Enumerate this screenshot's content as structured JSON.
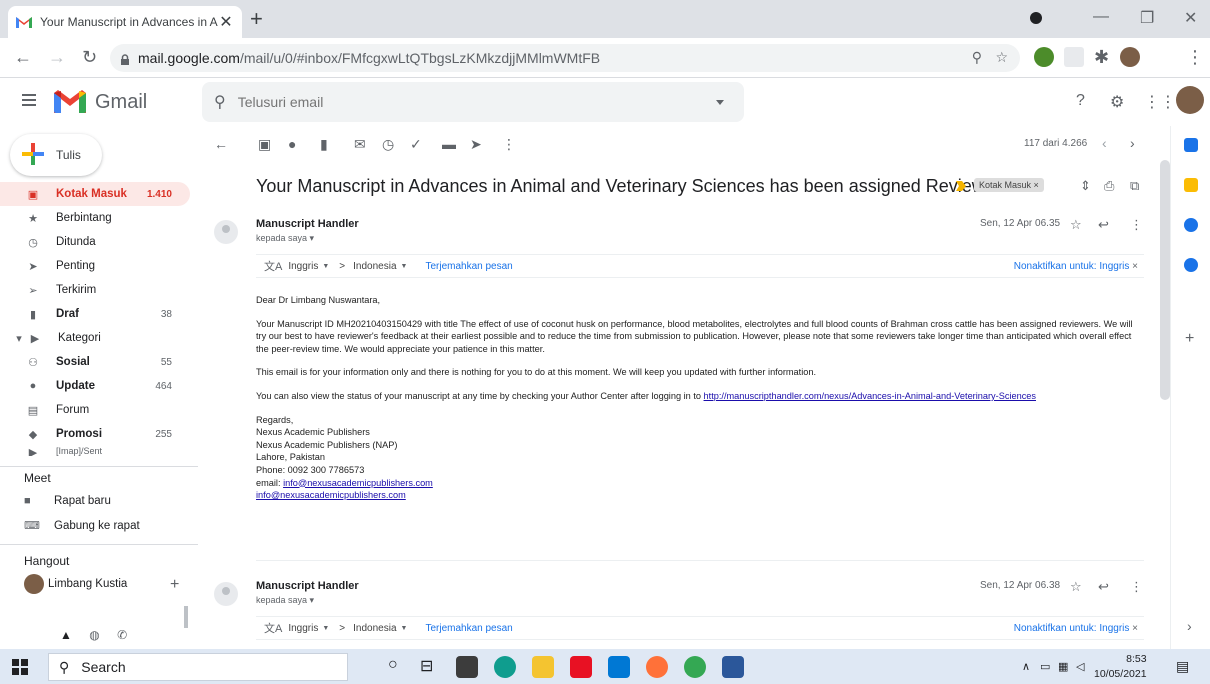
{
  "browser": {
    "tab_title": "Your Manuscript in Advances in A",
    "tab_close": "✕",
    "new_tab": "+",
    "url_host": "mail.google.com",
    "url_path": "/mail/u/0/#inbox/FMfcgxwLtQTbgsLzKMkzdjjMMlmWMtFB"
  },
  "gmail": {
    "logo_text": "Gmail",
    "search_placeholder": "Telusuri email",
    "compose_label": "Tulis"
  },
  "sidebar": {
    "items": [
      {
        "label": "Kotak Masuk",
        "count": "1.410",
        "icon": "inbox-icon"
      },
      {
        "label": "Berbintang",
        "count": "",
        "icon": "star-icon"
      },
      {
        "label": "Ditunda",
        "count": "",
        "icon": "clock-icon"
      },
      {
        "label": "Penting",
        "count": "",
        "icon": "important-icon"
      },
      {
        "label": "Terkirim",
        "count": "",
        "icon": "send-icon"
      },
      {
        "label": "Draf",
        "count": "38",
        "icon": "draft-icon"
      },
      {
        "label": "Kategori",
        "count": "",
        "icon": "label-icon"
      },
      {
        "label": "Sosial",
        "count": "55",
        "icon": "people-icon"
      },
      {
        "label": "Update",
        "count": "464",
        "icon": "info-icon"
      },
      {
        "label": "Forum",
        "count": "",
        "icon": "forum-icon"
      },
      {
        "label": "Promosi",
        "count": "255",
        "icon": "tag-icon"
      },
      {
        "label": "[Imap]/Sent",
        "count": "",
        "icon": "label-icon"
      }
    ],
    "meet_title": "Meet",
    "meet_new": "Rapat baru",
    "meet_join": "Gabung ke rapat",
    "hangout_title": "Hangout",
    "hangout_user": "Limbang Kustia"
  },
  "toolbar": {
    "pager": "117 dari 4.266"
  },
  "email": {
    "subject": "Your Manuscript in Advances in Animal and Veterinary Sciences has been assigned Reviewers",
    "label_tag": "Kotak Masuk ×",
    "messages": [
      {
        "sender": "Manuscript Handler",
        "to": "kepada saya ▾",
        "date": "Sen, 12 Apr 06.35"
      },
      {
        "sender": "Manuscript Handler",
        "to": "kepada saya ▾",
        "date": "Sen, 12 Apr 06.38"
      }
    ],
    "translate": {
      "from": "Inggris",
      "arrow": ">",
      "to": "Indonesia",
      "link": "Terjemahkan pesan",
      "off": "Nonaktifkan untuk: Inggris"
    },
    "body": {
      "greeting": "Dear Dr Limbang Nuswantara,",
      "p1": "Your Manuscript ID MH20210403150429 with title The effect of use of coconut husk on performance, blood metabolites, electrolytes and full blood counts of Brahman cross cattle has been assigned reviewers. We will try our best to have reviewer's feedback at their earliest possible and to reduce the time from submission to publication. However, please note that some reviewers take longer time than anticipated which overall effect the peer-review time. We would appreciate your patience in this matter.",
      "p2": "This email is for your information only and there is nothing for you to do at this moment. We will keep you updated with further information.",
      "p3": "You can also view the status of your manuscript at any time by checking your Author Center after logging in to ",
      "link": "http://manuscripthandler.com/nexus/Advances-in-Animal-and-Veterinary-Sciences",
      "sig": [
        "Regards,",
        "Nexus Academic Publishers",
        "Nexus Academic Publishers (NAP)",
        "Lahore, Pakistan",
        "Phone: 0092 300 7786573"
      ],
      "email_label": "email: ",
      "email1": "info@nexusacademicpublishers.com",
      "email2": "info@nexusacademicpublishers.com"
    }
  },
  "taskbar": {
    "search": "Search",
    "time": "8:53",
    "date": "10/05/2021"
  },
  "colors": {
    "accent_red": "#d93025",
    "link_blue": "#1a73e8",
    "active_bg": "#fce8e6"
  }
}
